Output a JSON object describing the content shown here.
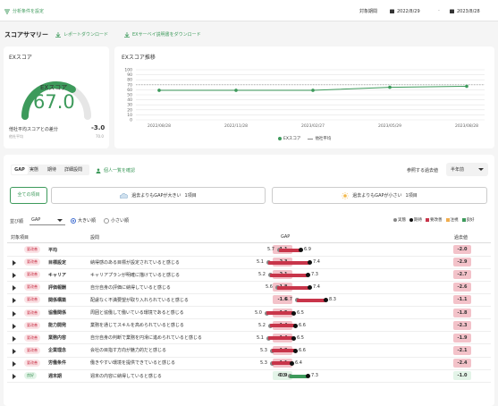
{
  "toolbar": {
    "filter_label": "分析条件を設定",
    "period_label": "対象期間",
    "date_from": "2022/8/29",
    "date_to": "2023/8/28",
    "range_sep": "-"
  },
  "summary": {
    "title": "スコアサマリー",
    "download_report": "レポートダウンロード",
    "download_survey": "EXサーベイ説明書をダウンロード"
  },
  "ex_score": {
    "card_title": "EXスコア",
    "gauge_label": "EXスコア",
    "value": "67.0",
    "gauge_fraction": 0.67,
    "diff_label": "他社平均スコアとの差分",
    "diff_value": "-3.0",
    "sub_label": "他社平均",
    "sub_value": "70.0"
  },
  "colors": {
    "brand_green": "#3d9a5b",
    "negative_red": "#c8354a",
    "gap_bg": "#f3c2c9",
    "good_bg": "#e3f4e8"
  },
  "chart_data": {
    "type": "line",
    "title": "EXスコア推移",
    "x": [
      "2022/08/28",
      "2022/11/28",
      "2023/02/27",
      "2023/05/29",
      "2023/08/28"
    ],
    "series": [
      {
        "name": "EXスコア",
        "values": [
          59,
          59,
          59,
          65,
          67
        ]
      },
      {
        "name": "他社平均",
        "values": [
          70,
          70,
          70,
          70,
          70
        ]
      }
    ],
    "ylim": [
      0,
      100
    ],
    "yticks": [
      "0",
      "10",
      "20",
      "30",
      "40",
      "50",
      "60",
      "70",
      "80",
      "90",
      "100"
    ],
    "grid": true,
    "legend": "bottom"
  },
  "tabs": [
    "GAP",
    "実態",
    "期待",
    "詳細設問"
  ],
  "individual_link": "個人一覧を確認",
  "compare": {
    "label": "参照する過去値",
    "selected": "半年前"
  },
  "filter_buttons": {
    "all": "全ての項目",
    "bigger": "過去よりもGAPが大きい",
    "bigger_count": "1項目",
    "smaller": "過去よりもGAPが小さい",
    "smaller_count": "1項目"
  },
  "sort": {
    "label": "並び順",
    "selected": "GAP",
    "opt_desc": "大きい順",
    "opt_asc": "小さい順"
  },
  "legend": [
    "実態",
    "期待",
    "要改善",
    "注視",
    "良好"
  ],
  "table": {
    "headers": [
      "対象項目",
      "設問",
      "GAP",
      "過去値"
    ],
    "rows": [
      {
        "expand": false,
        "badge": "要改善",
        "item": "平均",
        "question": "",
        "gap": "-1.1",
        "real": "5.7",
        "expect": "6.9",
        "past": "-2.0"
      },
      {
        "expand": true,
        "badge": "要改善",
        "item": "目標設定",
        "question": "納得感のある目標が設定されていると感じる",
        "gap": "-2.3",
        "real": "5.1",
        "expect": "7.4",
        "past": "-2.9"
      },
      {
        "expand": true,
        "badge": "要改善",
        "item": "キャリア",
        "question": "キャリアプランが明確に描けていると感じる",
        "gap": "-2.1",
        "real": "5.2",
        "expect": "7.3",
        "past": "-2.7"
      },
      {
        "expand": true,
        "badge": "要改善",
        "item": "評価報酬",
        "question": "自分自身の評価に納得していると感じる",
        "gap": "-1.8",
        "real": "5.6",
        "expect": "7.4",
        "past": "-2.6"
      },
      {
        "expand": true,
        "badge": "要改善",
        "item": "関係構築",
        "question": "配慮なく不満要望が取り入れられていると感じる",
        "gap": "-1.6",
        "real": "6.7",
        "expect": "8.3",
        "past": "-1.1"
      },
      {
        "expand": true,
        "badge": "要改善",
        "item": "協働関係",
        "question": "周囲と協働して働いている環境であると感じる",
        "gap": "-1.5",
        "real": "5.0",
        "expect": "6.5",
        "past": "-1.8"
      },
      {
        "expand": true,
        "badge": "要改善",
        "item": "能力開発",
        "question": "業務を通じてスキルを高められていると感じる",
        "gap": "-1.4",
        "real": "5.2",
        "expect": "6.6",
        "past": "-2.3"
      },
      {
        "expand": true,
        "badge": "要改善",
        "item": "業務内容",
        "question": "自分自身の判断で業務を円滑に進められていると感じる",
        "gap": "-1.4",
        "real": "5.1",
        "expect": "6.5",
        "past": "-1.9"
      },
      {
        "expand": true,
        "badge": "要改善",
        "item": "企業理念",
        "question": "会社の目指す方向が魅力的だと感じる",
        "gap": "-1.3",
        "real": "5.3",
        "expect": "6.6",
        "past": "-2.1"
      },
      {
        "expand": true,
        "badge": "要改善",
        "item": "労働条件",
        "question": "働きやすい環境を提供できていると感じる",
        "gap": "-1.1",
        "real": "5.3",
        "expect": "6.4",
        "past": "-2.4"
      },
      {
        "expand": true,
        "badge": "良好",
        "item": "週末期",
        "question": "週末の内容に納得していると感じる",
        "gap": "-0.9",
        "real": "6.3",
        "expect": "7.3",
        "past": "-1.0"
      }
    ]
  }
}
